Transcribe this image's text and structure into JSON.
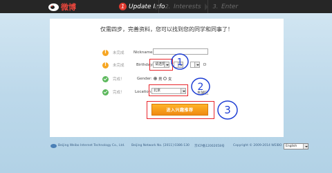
{
  "brand": {
    "name": "微博"
  },
  "steps": [
    {
      "num": "1",
      "label": "Update Info"
    },
    {
      "num": "2.",
      "label": "Interests"
    },
    {
      "num": "3.",
      "label": "Enter"
    }
  ],
  "headline": "仅需四步，完善资料，您可以找到您的同学和同事了！",
  "form": {
    "nickname": {
      "status": "未完成",
      "label": "Nickname:",
      "value": ""
    },
    "birthday": {
      "status": "未完成",
      "label": "Birthday:",
      "year_value": "请选择",
      "year_suffix": "Y",
      "day_suffix": "D"
    },
    "gender": {
      "status": "完成！",
      "label": "Gender:",
      "male": "男",
      "female": "女"
    },
    "location": {
      "status": "完成！",
      "label": "Location:",
      "province": "北京",
      "district": "东城区"
    },
    "submit_label": "进入兴趣推荐"
  },
  "annotations": {
    "one": "1",
    "two": "2",
    "three": "3"
  },
  "footer": {
    "company": "Beijing Weibo Internet Technology Co., Ltd.",
    "network": "Beijing Network No. [2011] 0386-130",
    "icp": "京ICP备12002058号",
    "copyright": "Copyright © 2009-2014 WEIBO",
    "language": "English"
  },
  "colors": {
    "topbar": "#262626",
    "accent_red": "#e03a2f",
    "button_orange": "#f5a01c",
    "annotation_red": "#e8242a",
    "annotation_blue": "#1f3fd4"
  }
}
